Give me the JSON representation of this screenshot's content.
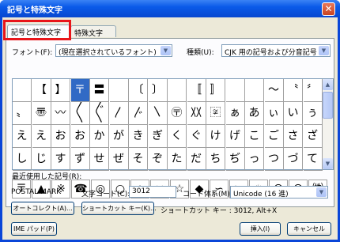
{
  "window": {
    "title": "記号と特殊文字",
    "close_glyph": "✕"
  },
  "tabs": [
    {
      "label": "記号と特殊文字",
      "active": true
    },
    {
      "label": "特殊文字",
      "active": false
    }
  ],
  "font": {
    "label": "フォント(F):",
    "value": "(現在選択されているフォント)"
  },
  "subset": {
    "label": "種類(U):",
    "value": "CJK 用の記号および分音記号"
  },
  "grid_rows": [
    [
      "",
      "【",
      "】",
      "〒",
      "〓",
      "",
      "〔",
      "〕",
      "",
      "〚",
      "〛",
      "",
      "",
      "〜",
      "〝",
      "〞"
    ],
    [
      "〟",
      "〠",
      "〰",
      "〱",
      "〲",
      "〳",
      "〴",
      "〵",
      "〶",
      "〷",
      "〾",
      "ぁ",
      "あ",
      "ぃ",
      "い",
      "ぅ"
    ],
    [
      "え",
      "え",
      "お",
      "お",
      "か",
      "が",
      "き",
      "ぎ",
      "く",
      "ぐ",
      "け",
      "げ",
      "こ",
      "ご",
      "さ",
      "ざ"
    ],
    [
      "し",
      "じ",
      "す",
      "ず",
      "せ",
      "ぜ",
      "そ",
      "ぞ",
      "た",
      "だ",
      "ち",
      "ぢ",
      "っ",
      "つ",
      "づ",
      "て"
    ]
  ],
  "recent": {
    "label": "最近使用した記号(R):",
    "symbols": [
      "〒",
      "▲",
      "※",
      "☎",
      "◎",
      "○",
      "△",
      "×",
      "☆",
      "◆",
      "∽",
      "✂",
      "♨",
      "☺",
      "☹",
      "㈱"
    ]
  },
  "char_name": "POSTAL MARK",
  "char_code": {
    "label": "文字コード(C):",
    "value": "3012"
  },
  "code_system": {
    "label": "コード体系(M):",
    "value": "Unicode (16 進)"
  },
  "buttons": {
    "autocorrect": "オートコレクト(A)...",
    "shortcut_key": "ショートカット キー(K)...",
    "shortcut_info": "ショートカット キー : 3012, Alt+X",
    "ime_pad": "IME パッド(P)",
    "insert": "挿入(I)",
    "cancel": "キャンセル"
  },
  "colors": {
    "highlight": "#e8151a",
    "selection": "#316ac5",
    "titlebar": "#0a5ae8"
  }
}
